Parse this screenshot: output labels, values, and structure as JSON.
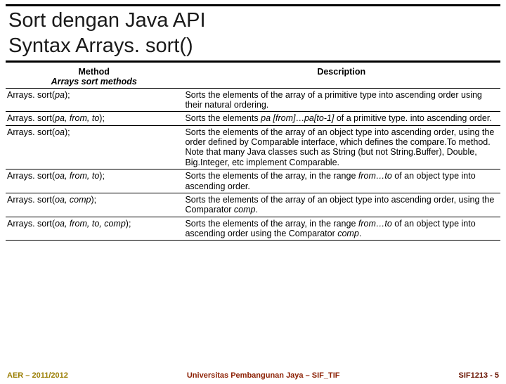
{
  "title_line1": "Sort dengan Java API",
  "title_line2": "Syntax Arrays. sort()",
  "headers": {
    "method": "Method",
    "subheader": "Arrays sort methods",
    "description": "Description"
  },
  "rows": [
    {
      "method_plain": "Arrays. sort(",
      "method_args": "pa",
      "method_tail": ");",
      "desc": "Sorts the elements of the array of a primitive type into ascending order using their natural ordering."
    },
    {
      "method_plain": "Arrays. sort(",
      "method_args": "pa, from, to",
      "method_tail": ");",
      "desc_html": "Sorts the elements <span class=\"i\">pa [from]</span>…<span class=\"i\">pa[to-1]</span> of a primitive type. into ascending order."
    },
    {
      "method_plain": "Arrays. sort(",
      "method_args": "oa",
      "method_tail": ");",
      "desc": "Sorts the elements of the array of an object type into ascending order, using the order defined by Comparable interface, which defines the compare.To method. Note that many Java classes such as String (but not String.Buffer), Double, Big.Integer, etc implement Comparable."
    },
    {
      "method_plain": "Arrays. sort(",
      "method_args": "oa, from, to",
      "method_tail": ");",
      "desc_html": "Sorts the elements of the array, in the range <span class=\"i\">from…to</span> of an object type into ascending order."
    },
    {
      "method_plain": "Arrays. sort(",
      "method_args": "oa, comp",
      "method_tail": ");",
      "desc_html": "Sorts the elements of the array of an object type into ascending order, using the Comparator <span class=\"i\">comp</span>."
    },
    {
      "method_plain": "Arrays. sort(",
      "method_args": "oa, from, to, comp",
      "method_tail": ");",
      "desc_html": "Sorts the elements of the array, in the range <span class=\"i\">from…to</span> of an object type into ascending order using the Comparator <span class=\"i\">comp</span>."
    }
  ],
  "footer": {
    "left": "AER – 2011/2012",
    "mid": "Universitas Pembangunan Jaya – SIF_TIF",
    "right": "SIF1213 - 5"
  }
}
